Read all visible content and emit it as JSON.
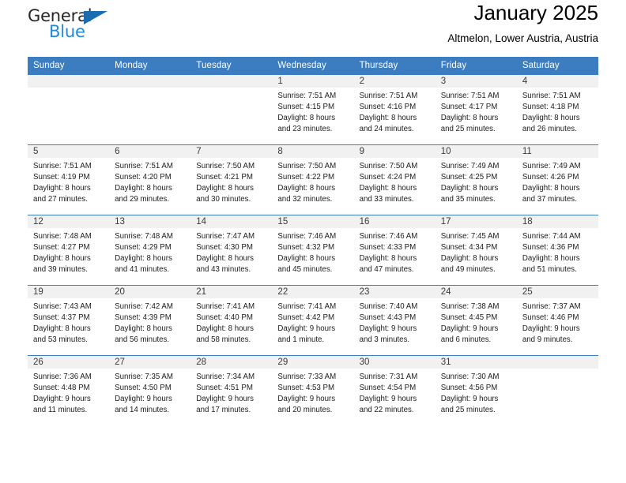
{
  "brand": {
    "logo_text_primary": "General",
    "logo_text_secondary": "Blue",
    "logo_triangle_color": "#1b6cb0",
    "logo_secondary_color": "#2389d6"
  },
  "header": {
    "title": "January 2025",
    "subtitle": "Altmelon, Lower Austria, Austria"
  },
  "theme": {
    "header_bar_color": "#3b7dc0",
    "daynum_band_color": "#f1f1f1",
    "cell_background": "#ffffff"
  },
  "weekdays": [
    "Sunday",
    "Monday",
    "Tuesday",
    "Wednesday",
    "Thursday",
    "Friday",
    "Saturday"
  ],
  "weeks": [
    [
      {
        "day": "",
        "lines": []
      },
      {
        "day": "",
        "lines": []
      },
      {
        "day": "",
        "lines": []
      },
      {
        "day": "1",
        "lines": [
          "Sunrise: 7:51 AM",
          "Sunset: 4:15 PM",
          "Daylight: 8 hours",
          "and 23 minutes."
        ]
      },
      {
        "day": "2",
        "lines": [
          "Sunrise: 7:51 AM",
          "Sunset: 4:16 PM",
          "Daylight: 8 hours",
          "and 24 minutes."
        ]
      },
      {
        "day": "3",
        "lines": [
          "Sunrise: 7:51 AM",
          "Sunset: 4:17 PM",
          "Daylight: 8 hours",
          "and 25 minutes."
        ]
      },
      {
        "day": "4",
        "lines": [
          "Sunrise: 7:51 AM",
          "Sunset: 4:18 PM",
          "Daylight: 8 hours",
          "and 26 minutes."
        ]
      }
    ],
    [
      {
        "day": "5",
        "lines": [
          "Sunrise: 7:51 AM",
          "Sunset: 4:19 PM",
          "Daylight: 8 hours",
          "and 27 minutes."
        ]
      },
      {
        "day": "6",
        "lines": [
          "Sunrise: 7:51 AM",
          "Sunset: 4:20 PM",
          "Daylight: 8 hours",
          "and 29 minutes."
        ]
      },
      {
        "day": "7",
        "lines": [
          "Sunrise: 7:50 AM",
          "Sunset: 4:21 PM",
          "Daylight: 8 hours",
          "and 30 minutes."
        ]
      },
      {
        "day": "8",
        "lines": [
          "Sunrise: 7:50 AM",
          "Sunset: 4:22 PM",
          "Daylight: 8 hours",
          "and 32 minutes."
        ]
      },
      {
        "day": "9",
        "lines": [
          "Sunrise: 7:50 AM",
          "Sunset: 4:24 PM",
          "Daylight: 8 hours",
          "and 33 minutes."
        ]
      },
      {
        "day": "10",
        "lines": [
          "Sunrise: 7:49 AM",
          "Sunset: 4:25 PM",
          "Daylight: 8 hours",
          "and 35 minutes."
        ]
      },
      {
        "day": "11",
        "lines": [
          "Sunrise: 7:49 AM",
          "Sunset: 4:26 PM",
          "Daylight: 8 hours",
          "and 37 minutes."
        ]
      }
    ],
    [
      {
        "day": "12",
        "lines": [
          "Sunrise: 7:48 AM",
          "Sunset: 4:27 PM",
          "Daylight: 8 hours",
          "and 39 minutes."
        ]
      },
      {
        "day": "13",
        "lines": [
          "Sunrise: 7:48 AM",
          "Sunset: 4:29 PM",
          "Daylight: 8 hours",
          "and 41 minutes."
        ]
      },
      {
        "day": "14",
        "lines": [
          "Sunrise: 7:47 AM",
          "Sunset: 4:30 PM",
          "Daylight: 8 hours",
          "and 43 minutes."
        ]
      },
      {
        "day": "15",
        "lines": [
          "Sunrise: 7:46 AM",
          "Sunset: 4:32 PM",
          "Daylight: 8 hours",
          "and 45 minutes."
        ]
      },
      {
        "day": "16",
        "lines": [
          "Sunrise: 7:46 AM",
          "Sunset: 4:33 PM",
          "Daylight: 8 hours",
          "and 47 minutes."
        ]
      },
      {
        "day": "17",
        "lines": [
          "Sunrise: 7:45 AM",
          "Sunset: 4:34 PM",
          "Daylight: 8 hours",
          "and 49 minutes."
        ]
      },
      {
        "day": "18",
        "lines": [
          "Sunrise: 7:44 AM",
          "Sunset: 4:36 PM",
          "Daylight: 8 hours",
          "and 51 minutes."
        ]
      }
    ],
    [
      {
        "day": "19",
        "lines": [
          "Sunrise: 7:43 AM",
          "Sunset: 4:37 PM",
          "Daylight: 8 hours",
          "and 53 minutes."
        ]
      },
      {
        "day": "20",
        "lines": [
          "Sunrise: 7:42 AM",
          "Sunset: 4:39 PM",
          "Daylight: 8 hours",
          "and 56 minutes."
        ]
      },
      {
        "day": "21",
        "lines": [
          "Sunrise: 7:41 AM",
          "Sunset: 4:40 PM",
          "Daylight: 8 hours",
          "and 58 minutes."
        ]
      },
      {
        "day": "22",
        "lines": [
          "Sunrise: 7:41 AM",
          "Sunset: 4:42 PM",
          "Daylight: 9 hours",
          "and 1 minute."
        ]
      },
      {
        "day": "23",
        "lines": [
          "Sunrise: 7:40 AM",
          "Sunset: 4:43 PM",
          "Daylight: 9 hours",
          "and 3 minutes."
        ]
      },
      {
        "day": "24",
        "lines": [
          "Sunrise: 7:38 AM",
          "Sunset: 4:45 PM",
          "Daylight: 9 hours",
          "and 6 minutes."
        ]
      },
      {
        "day": "25",
        "lines": [
          "Sunrise: 7:37 AM",
          "Sunset: 4:46 PM",
          "Daylight: 9 hours",
          "and 9 minutes."
        ]
      }
    ],
    [
      {
        "day": "26",
        "lines": [
          "Sunrise: 7:36 AM",
          "Sunset: 4:48 PM",
          "Daylight: 9 hours",
          "and 11 minutes."
        ]
      },
      {
        "day": "27",
        "lines": [
          "Sunrise: 7:35 AM",
          "Sunset: 4:50 PM",
          "Daylight: 9 hours",
          "and 14 minutes."
        ]
      },
      {
        "day": "28",
        "lines": [
          "Sunrise: 7:34 AM",
          "Sunset: 4:51 PM",
          "Daylight: 9 hours",
          "and 17 minutes."
        ]
      },
      {
        "day": "29",
        "lines": [
          "Sunrise: 7:33 AM",
          "Sunset: 4:53 PM",
          "Daylight: 9 hours",
          "and 20 minutes."
        ]
      },
      {
        "day": "30",
        "lines": [
          "Sunrise: 7:31 AM",
          "Sunset: 4:54 PM",
          "Daylight: 9 hours",
          "and 22 minutes."
        ]
      },
      {
        "day": "31",
        "lines": [
          "Sunrise: 7:30 AM",
          "Sunset: 4:56 PM",
          "Daylight: 9 hours",
          "and 25 minutes."
        ]
      },
      {
        "day": "",
        "lines": []
      }
    ]
  ]
}
